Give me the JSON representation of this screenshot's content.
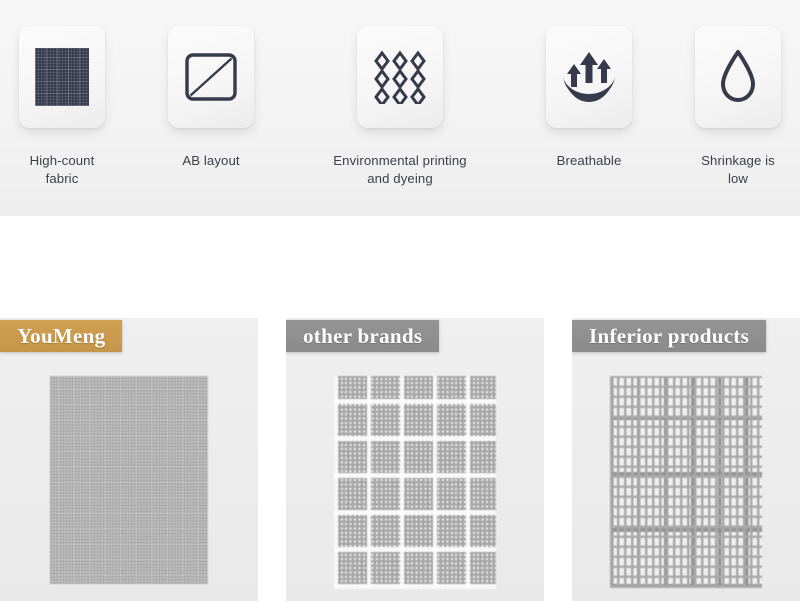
{
  "features": {
    "items": [
      {
        "icon": "fabric-swatch-icon",
        "label": "High-count fabric"
      },
      {
        "icon": "ab-layout-icon",
        "label": "AB layout"
      },
      {
        "icon": "diamond-grid-icon",
        "label": "Environmental printing\nand dyeing"
      },
      {
        "icon": "breathable-arrows-icon",
        "label": "Breathable"
      },
      {
        "icon": "water-drop-icon",
        "label": "Shrinkage is low"
      }
    ]
  },
  "comparison": {
    "panels": [
      {
        "badge_label": "YouMeng",
        "badge_color": "#c5964a",
        "swatch_name": "dense-fine-weave",
        "swatch_description": "Dense uniform high-count weave"
      },
      {
        "badge_label": "other brands",
        "badge_color": "#8b8b8b",
        "swatch_name": "medium-plaid-weave",
        "swatch_description": "Medium density weave with gaps"
      },
      {
        "badge_label": "Inferior products",
        "badge_color": "#8b8b8b",
        "swatch_name": "sparse-open-weave",
        "swatch_description": "Sparse loose open grid weave"
      }
    ]
  },
  "colors": {
    "section_background": "#f4f4f4",
    "page_background": "#ffffff",
    "icon_stroke": "#363a4d",
    "label_text": "#3d4049",
    "panel_background": "#ededed",
    "gold_badge": "#c5964a",
    "gray_badge": "#8b8b8b",
    "weave_thread": "#a6a6a6"
  }
}
